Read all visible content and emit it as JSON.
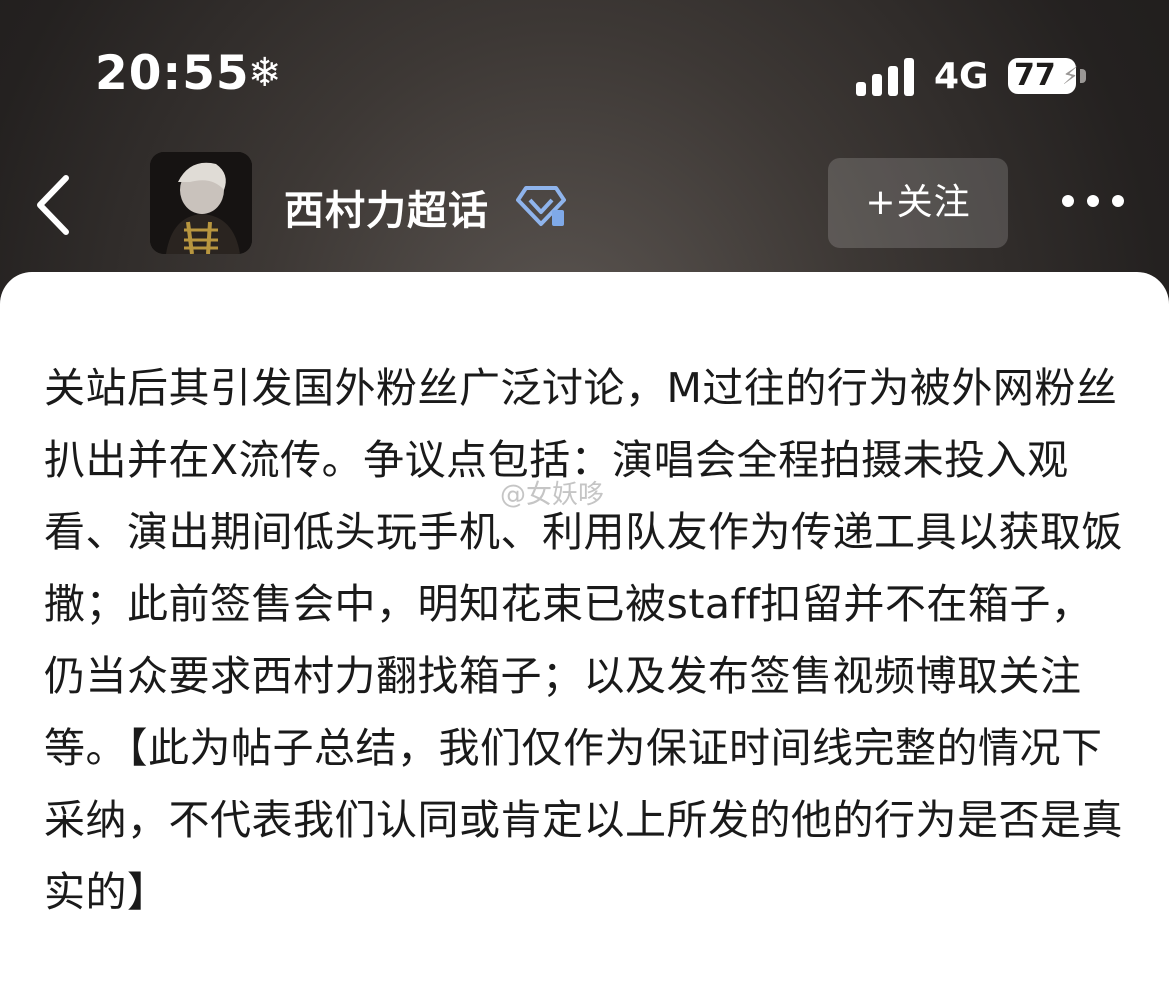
{
  "status_bar": {
    "time": "20:55",
    "weather_icon": "snowflake-icon",
    "network": "4G",
    "battery": "77"
  },
  "nav": {
    "back_icon": "chevron-left-icon",
    "topic_title": "西村力超话",
    "badge_icon": "diamond-badge-icon",
    "follow_label": "+关注",
    "more_icon": "more-dots-icon"
  },
  "post": {
    "text": "关站后其引发国外粉丝广泛讨论，M过往的行为被外网粉丝扒出并在X流传。争议点包括：演唱会全程拍摄未投入观看、演出期间低头玩手机、利用队友作为传递工具以获取饭撒；此前签售会中，明知花束已被staff扣留并不在箱子，仍当众要求西村力翻找箱子；以及发布签售视频博取关注等。【此为帖子总结，我们仅作为保证时间线完整的情况下采纳，不代表我们认同或肯定以上所发的他的行为是否是真实的】",
    "watermark": "@女妖哆"
  },
  "colors": {
    "header_bg": "#2e2a28",
    "card_bg": "#ffffff",
    "text": "#1a1a1a",
    "badge": "#7fa9e8"
  }
}
